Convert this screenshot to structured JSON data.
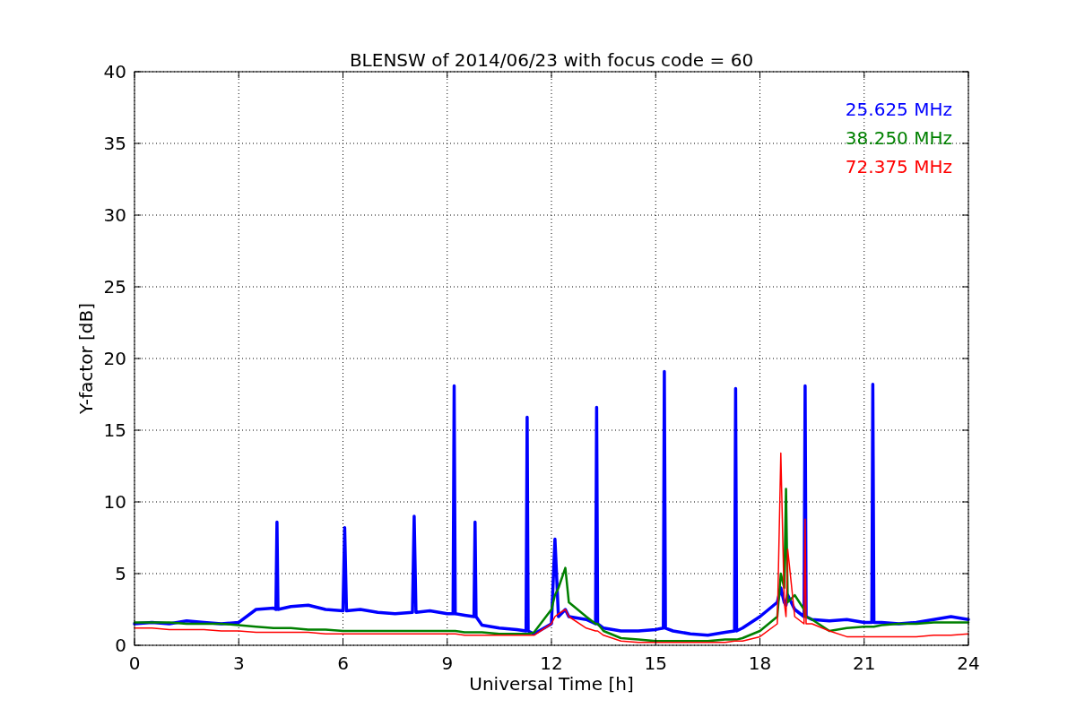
{
  "plot": {
    "chart_data": {
      "type": "line",
      "title": "BLENSW of 2014/06/23 with focus code = 60",
      "xlabel": "Universal Time [h]",
      "ylabel": "Y-factor [dB]",
      "x": [
        0,
        0.5,
        1,
        1.5,
        2,
        2.5,
        3,
        3.5,
        4,
        4.07,
        4.1,
        4.13,
        4.5,
        5,
        5.5,
        6,
        6.05,
        6.1,
        6.5,
        7,
        7.5,
        8,
        8.05,
        8.1,
        8.5,
        9,
        9.17,
        9.2,
        9.23,
        9.5,
        9.77,
        9.8,
        9.83,
        10,
        10.5,
        11,
        11.27,
        11.3,
        11.33,
        11.5,
        12,
        12.1,
        12.2,
        12.4,
        12.5,
        13,
        13.27,
        13.3,
        13.33,
        13.5,
        14,
        14.5,
        15,
        15.22,
        15.25,
        15.28,
        15.5,
        16,
        16.5,
        17,
        17.27,
        17.3,
        17.33,
        17.5,
        18,
        18.5,
        18.6,
        18.7,
        18.75,
        18.8,
        19,
        19.27,
        19.3,
        19.33,
        19.5,
        20,
        20.5,
        21,
        21.22,
        21.25,
        21.28,
        21.5,
        22,
        22.5,
        23,
        23.5,
        24
      ],
      "series": [
        {
          "name": "25.625 MHz",
          "color": "#0000ff",
          "values": [
            1.5,
            1.6,
            1.5,
            1.7,
            1.6,
            1.5,
            1.6,
            2.5,
            2.6,
            2.5,
            8.6,
            2.5,
            2.7,
            2.8,
            2.5,
            2.4,
            8.2,
            2.4,
            2.5,
            2.3,
            2.2,
            2.3,
            9.0,
            2.3,
            2.4,
            2.2,
            2.2,
            18.1,
            2.2,
            2.1,
            2.0,
            8.6,
            2.0,
            1.4,
            1.2,
            1.1,
            1.0,
            15.9,
            1.0,
            0.8,
            1.5,
            7.4,
            2.0,
            2.5,
            2.0,
            1.8,
            1.5,
            16.6,
            1.5,
            1.2,
            1.0,
            1.0,
            1.1,
            1.2,
            19.1,
            1.2,
            1.0,
            0.8,
            0.7,
            0.9,
            1.0,
            17.9,
            1.0,
            1.2,
            2.0,
            3.0,
            4.0,
            3.0,
            2.8,
            3.5,
            2.5,
            2.0,
            18.1,
            2.0,
            1.8,
            1.7,
            1.8,
            1.6,
            1.6,
            18.2,
            1.6,
            1.6,
            1.5,
            1.6,
            1.8,
            2.0,
            1.8
          ]
        },
        {
          "name": "38.250 MHz",
          "color": "#008000",
          "values": [
            1.6,
            1.6,
            1.6,
            1.5,
            1.5,
            1.5,
            1.4,
            1.3,
            1.2,
            1.2,
            1.2,
            1.2,
            1.2,
            1.1,
            1.1,
            1.0,
            1.0,
            1.0,
            1.0,
            1.0,
            1.0,
            1.0,
            1.0,
            1.0,
            1.0,
            1.0,
            1.0,
            1.0,
            1.0,
            0.9,
            0.9,
            0.9,
            0.9,
            0.9,
            0.8,
            0.8,
            0.8,
            0.8,
            0.8,
            0.9,
            2.5,
            3.5,
            4.0,
            5.4,
            3.0,
            2.0,
            1.5,
            1.5,
            1.5,
            1.0,
            0.5,
            0.4,
            0.3,
            0.3,
            0.3,
            0.3,
            0.3,
            0.3,
            0.3,
            0.4,
            0.4,
            0.4,
            0.4,
            0.5,
            1.0,
            2.0,
            5.0,
            4.0,
            10.9,
            3.0,
            3.5,
            2.5,
            2.0,
            2.0,
            1.8,
            1.0,
            1.2,
            1.3,
            1.3,
            1.3,
            1.3,
            1.4,
            1.5,
            1.5,
            1.6,
            1.6,
            1.6
          ]
        },
        {
          "name": "72.375 MHz",
          "color": "#ff0000",
          "values": [
            1.2,
            1.2,
            1.1,
            1.1,
            1.1,
            1.0,
            1.0,
            0.9,
            0.9,
            0.9,
            0.9,
            0.9,
            0.9,
            0.9,
            0.8,
            0.8,
            0.8,
            0.8,
            0.8,
            0.8,
            0.8,
            0.8,
            0.8,
            0.8,
            0.8,
            0.8,
            0.8,
            0.8,
            0.8,
            0.7,
            0.7,
            0.7,
            0.7,
            0.7,
            0.7,
            0.7,
            0.7,
            0.7,
            0.7,
            0.7,
            1.5,
            2.0,
            2.2,
            2.5,
            2.0,
            1.2,
            1.0,
            1.0,
            1.0,
            0.7,
            0.3,
            0.2,
            0.2,
            0.2,
            0.2,
            0.2,
            0.2,
            0.2,
            0.2,
            0.2,
            0.3,
            0.3,
            0.3,
            0.3,
            0.6,
            1.5,
            13.4,
            3.0,
            2.0,
            6.7,
            2.0,
            1.5,
            8.8,
            1.5,
            1.5,
            1.0,
            0.6,
            0.6,
            0.6,
            0.6,
            0.6,
            0.6,
            0.6,
            0.6,
            0.7,
            0.7,
            0.8
          ]
        }
      ],
      "xlim": [
        0,
        24
      ],
      "ylim": [
        0,
        40
      ],
      "grid": true,
      "xticks": [
        0,
        3,
        6,
        9,
        12,
        15,
        18,
        21,
        24
      ],
      "yticks": [
        0,
        5,
        10,
        15,
        20,
        25,
        30,
        35,
        40
      ]
    }
  }
}
